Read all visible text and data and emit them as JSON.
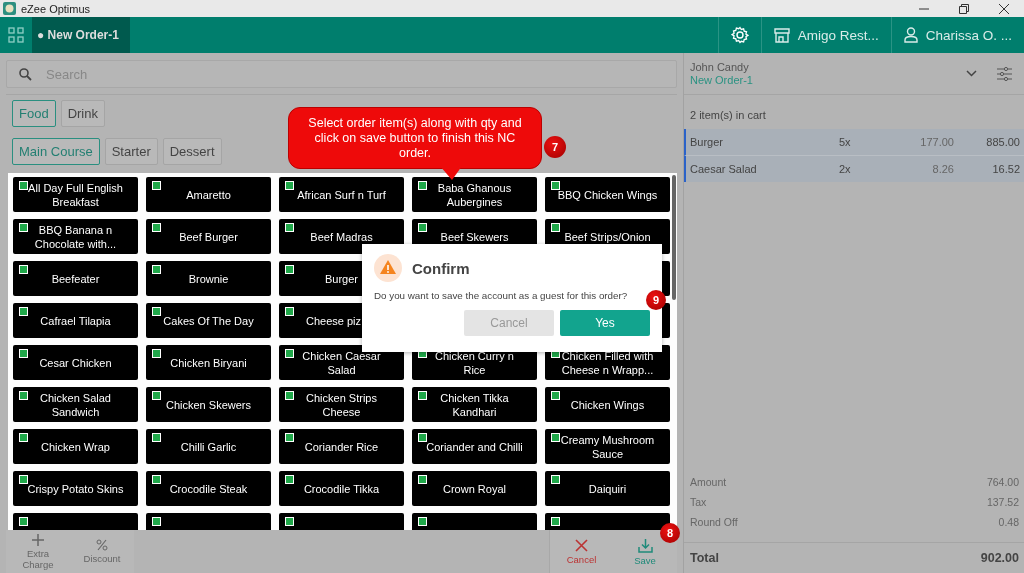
{
  "window": {
    "title": "eZee Optimus"
  },
  "header": {
    "order_tab": "● New Order-1",
    "outlet": "Amigo Rest...",
    "user": "Charissa O. ..."
  },
  "search": {
    "placeholder": "Search"
  },
  "categories": [
    {
      "label": "Food",
      "selected": true
    },
    {
      "label": "Drink",
      "selected": false
    }
  ],
  "subcategories": [
    {
      "label": "Main Course",
      "selected": true
    },
    {
      "label": "Starter",
      "selected": false
    },
    {
      "label": "Dessert",
      "selected": false
    }
  ],
  "items": [
    {
      "kind": "item",
      "label": "All Day Full English Breakfast"
    },
    {
      "kind": "item",
      "label": "Amaretto"
    },
    {
      "kind": "item",
      "label": "African Surf n Turf"
    },
    {
      "kind": "item",
      "label": "Baba Ghanous Aubergines"
    },
    {
      "kind": "item",
      "label": "BBQ Chicken Wings"
    },
    {
      "kind": "item",
      "label": "BBQ Banana n Chocolate with..."
    },
    {
      "kind": "item",
      "label": "Beef Burger"
    },
    {
      "kind": "item",
      "label": "Beef Madras"
    },
    {
      "kind": "item",
      "label": "Beef Skewers"
    },
    {
      "kind": "item",
      "label": "Beef Strips/Onion"
    },
    {
      "kind": "item",
      "label": "Beefeater"
    },
    {
      "kind": "item",
      "label": "Brownie"
    },
    {
      "kind": "item",
      "label": "Burger"
    },
    {
      "kind": "covered"
    },
    {
      "kind": "item",
      "label": "Cafrael Tilapia"
    },
    {
      "kind": "item",
      "label": "Cakes Of The Day"
    },
    {
      "kind": "cut",
      "label": "Cheese piz"
    },
    {
      "kind": "covered"
    },
    {
      "kind": "item",
      "label": "Cesar Chicken"
    },
    {
      "kind": "item",
      "label": "Chicken Biryani"
    },
    {
      "kind": "item",
      "label": "Chicken Caesar Salad"
    },
    {
      "kind": "item",
      "label": "Chicken Curry n Rice"
    },
    {
      "kind": "item",
      "label": "Chicken Filled with Cheese n Wrapp..."
    },
    {
      "kind": "item",
      "label": "Chicken Salad Sandwich"
    },
    {
      "kind": "item",
      "label": "Chicken Skewers"
    },
    {
      "kind": "item",
      "label": "Chicken Strips Cheese"
    },
    {
      "kind": "item",
      "label": "Chicken Tikka Kandhari"
    },
    {
      "kind": "item",
      "label": "Chicken Wings"
    },
    {
      "kind": "item",
      "label": "Chicken Wrap"
    },
    {
      "kind": "item",
      "label": "Chilli Garlic"
    },
    {
      "kind": "item",
      "label": "Coriander Rice"
    },
    {
      "kind": "item",
      "label": "Coriander and Chilli"
    },
    {
      "kind": "item",
      "label": "Creamy Mushroom Sauce"
    },
    {
      "kind": "item",
      "label": "Crispy Potato Skins"
    },
    {
      "kind": "item",
      "label": "Crocodile Steak"
    },
    {
      "kind": "item",
      "label": "Crocodile Tikka"
    },
    {
      "kind": "item",
      "label": "Crown Royal"
    },
    {
      "kind": "item",
      "label": "Daiquiri"
    },
    {
      "kind": "item"
    },
    {
      "kind": "item"
    },
    {
      "kind": "item"
    },
    {
      "kind": "item"
    },
    {
      "kind": "item"
    }
  ],
  "bottom_actions": [
    {
      "kind": "plus",
      "label": "Extra Charge"
    },
    {
      "kind": "percent",
      "label": "Discount"
    }
  ],
  "order_actions": [
    {
      "kind": "cancel",
      "label": "Cancel"
    },
    {
      "kind": "save",
      "label": "Save"
    }
  ],
  "cart": {
    "guest": "John Candy",
    "order": "New Order-1",
    "count": "2 item(s) in cart",
    "rows": [
      {
        "name": "Burger",
        "qty": "5x",
        "price": "177.00",
        "total": "885.00"
      },
      {
        "name": "Caesar Salad",
        "qty": "2x",
        "price": "8.26",
        "total": "16.52"
      }
    ],
    "totals": [
      {
        "label": "Amount",
        "value": "764.00"
      },
      {
        "label": "Tax",
        "value": "137.52"
      },
      {
        "label": "Round Off",
        "value": "0.48"
      }
    ],
    "grand_total": {
      "label": "Total",
      "value": "902.00"
    }
  },
  "dialog": {
    "title": "Confirm",
    "message": "Do you want to save the account as a guest for this order?",
    "buttons": [
      {
        "kind": "secondary",
        "label": "Cancel"
      },
      {
        "kind": "primary",
        "label": "Yes"
      }
    ]
  },
  "callout": {
    "text": "Select order item(s) along with qty and click on save button to finish this NC order."
  },
  "step_markers": [
    {
      "kind": "callout",
      "label": "7"
    },
    {
      "kind": "save",
      "label": "8"
    },
    {
      "kind": "dialog",
      "label": "9"
    }
  ]
}
